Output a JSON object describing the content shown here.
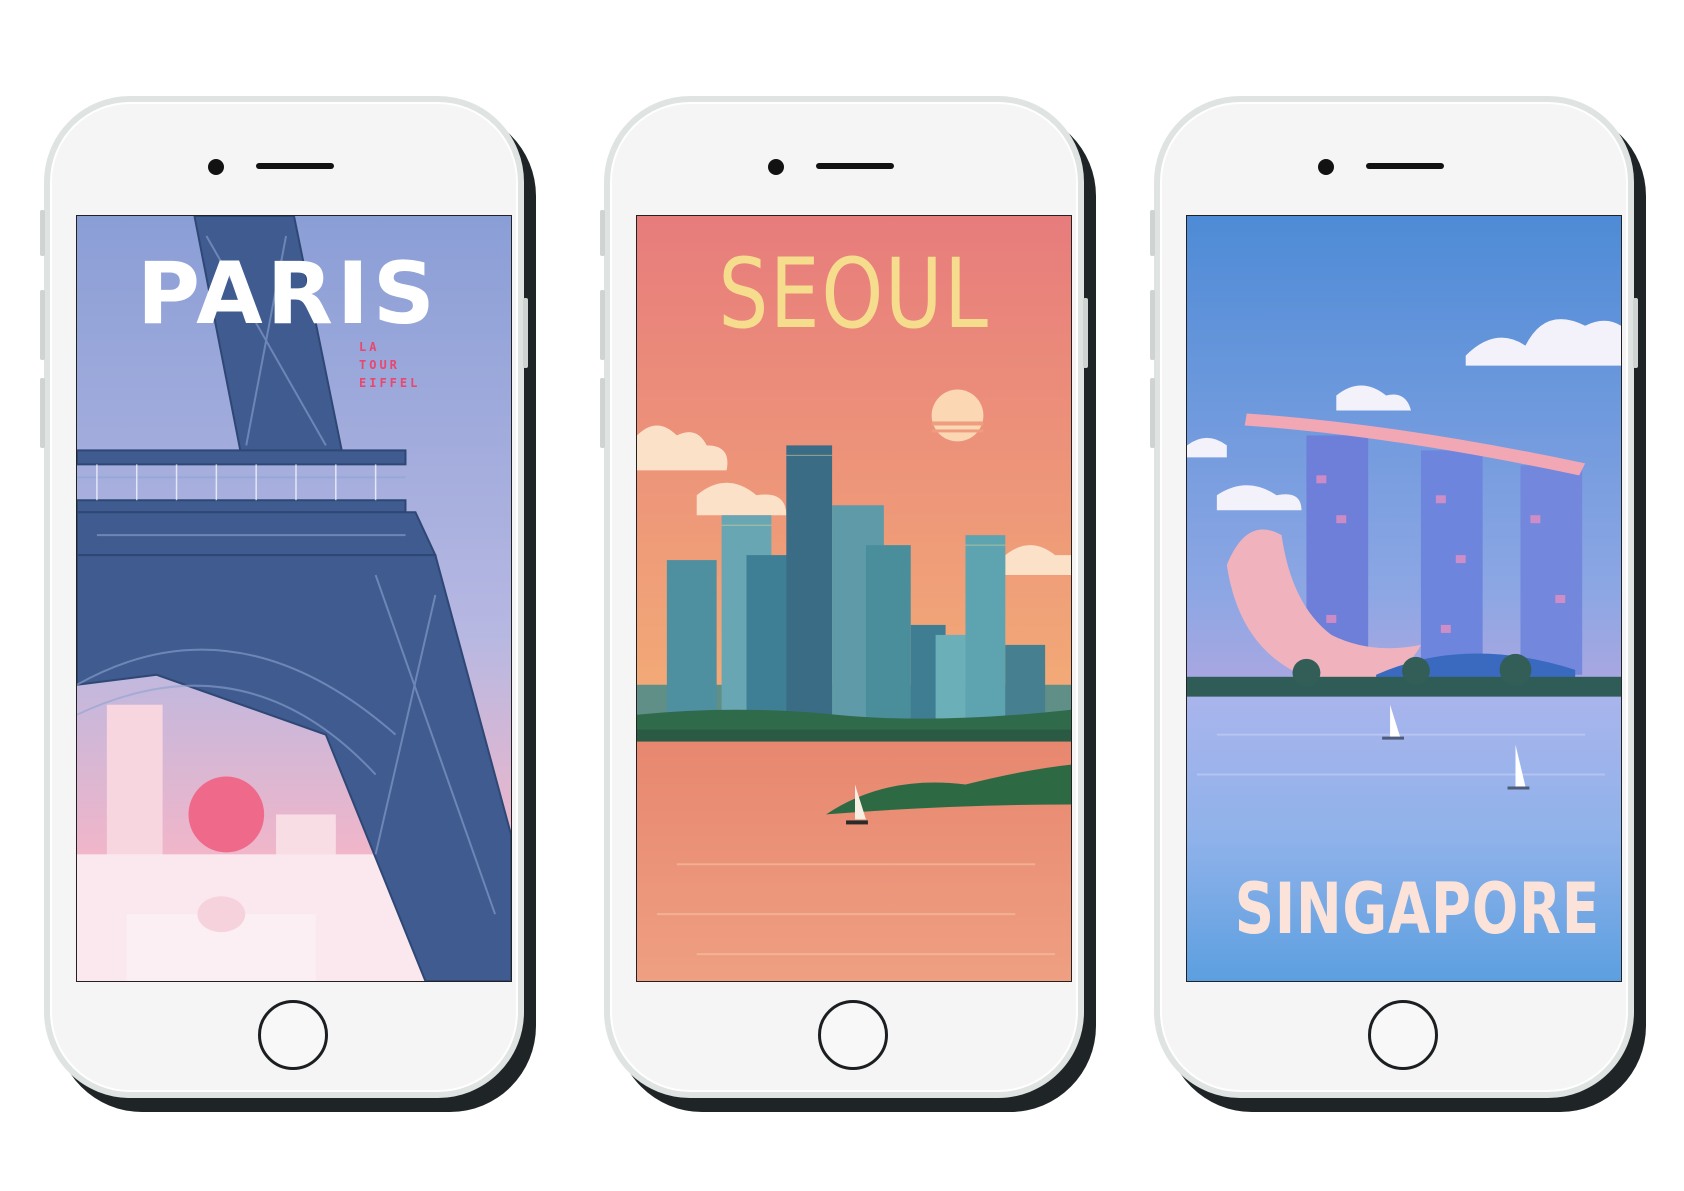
{
  "phones": [
    {
      "city": "PARIS",
      "subtitle_lines": [
        "LA",
        "TOUR",
        "EIFFEL"
      ]
    },
    {
      "city": "SEOUL"
    },
    {
      "city": "SINGAPORE"
    }
  ],
  "colors": {
    "phone_body": "#f4f5f4",
    "paris_sky_top": "#8a9ed6",
    "paris_sky_bottom": "#f4b6c8",
    "eiffel_steel": "#3f5b8f",
    "seoul_sky_top": "#e77c7c",
    "seoul_sky_bottom": "#f2a877",
    "seoul_title": "#f6dd8e",
    "singapore_sky_top": "#4e8bd6",
    "singapore_sky_bottom": "#d9a6dc",
    "singapore_title": "#fbe3d9"
  },
  "icons": [
    "camera-icon",
    "speaker-icon",
    "home-button-icon"
  ]
}
